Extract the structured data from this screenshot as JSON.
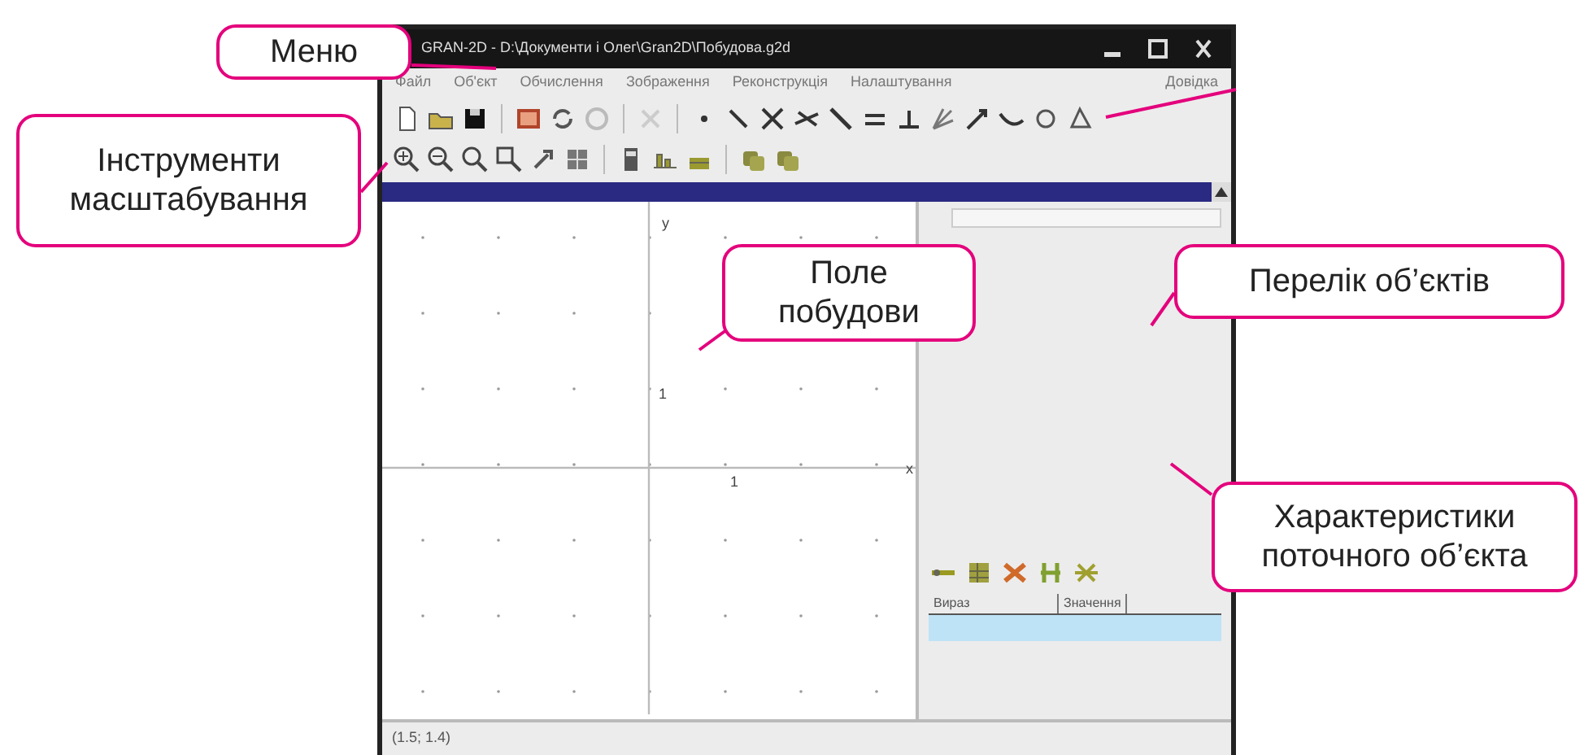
{
  "window": {
    "title": "GRAN-2D - D:\\Документи і Олег\\Gran2D\\Побудова.g2d"
  },
  "menu": [
    "Файл",
    "Об'єкт",
    "Обчислення",
    "Зображення",
    "Реконструкція",
    "Налаштування",
    "Довідка"
  ],
  "canvas": {
    "axis_labels": [
      {
        "kind": "y",
        "text": "y"
      },
      {
        "kind": "x",
        "text": "x"
      },
      {
        "kind": "ytick",
        "text": "1"
      },
      {
        "kind": "xtick",
        "text": "1"
      }
    ]
  },
  "properties": {
    "columns": [
      "Вираз",
      "Значення"
    ]
  },
  "status_bar": "(1.5; 1.4)",
  "callouts": [
    {
      "kind": "menu",
      "text": "Меню"
    },
    {
      "kind": "zoom",
      "text": "Інструменти масштабування"
    },
    {
      "kind": "field",
      "text": "Поле побудови"
    },
    {
      "kind": "list",
      "text": "Перелік об’єктів"
    },
    {
      "kind": "props",
      "text": "Характеристики поточного об’єкта"
    }
  ]
}
